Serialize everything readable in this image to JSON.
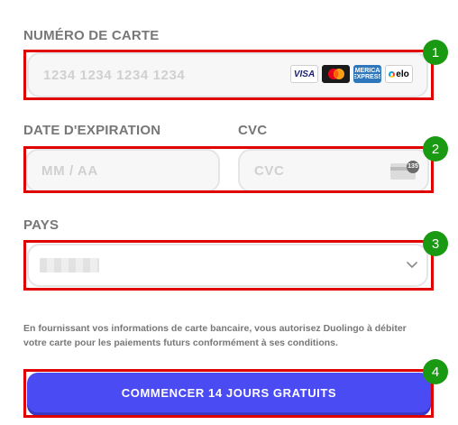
{
  "card_number": {
    "label": "NUMÉRO DE CARTE",
    "placeholder": "1234 1234 1234 1234",
    "value": "",
    "card_brands": [
      {
        "name": "visa",
        "text": "VISA",
        "icon": "visa-logo-icon"
      },
      {
        "name": "mastercard",
        "icon": "mastercard-logo-icon"
      },
      {
        "name": "amex",
        "text": "AMERICAN EXPRESS",
        "icon": "amex-logo-icon"
      },
      {
        "name": "elo",
        "text": "elo",
        "icon": "elo-logo-icon"
      }
    ]
  },
  "expiration": {
    "label": "DATE D'EXPIRATION",
    "placeholder": "MM / AA",
    "value": ""
  },
  "cvc": {
    "label": "CVC",
    "placeholder": "CVC",
    "value": "",
    "icon": "cvc-card-icon",
    "icon_text": "135"
  },
  "country": {
    "label": "PAYS",
    "selected_value": "",
    "icon": "chevron-down-icon"
  },
  "disclaimer": "En fournissant vos informations de carte bancaire, vous autorisez Duolingo à débiter votre carte pour les paiements futurs conformément à ses conditions.",
  "submit": {
    "label": "COMMENCER 14 JOURS GRATUITS"
  },
  "annotations": [
    {
      "number": "1"
    },
    {
      "number": "2"
    },
    {
      "number": "3"
    },
    {
      "number": "4"
    }
  ],
  "colors": {
    "accent": "#4b4bf4",
    "annotation_box": "#e00000",
    "annotation_marker": "#1a9a12",
    "label": "#777777",
    "placeholder": "#d0d0d0"
  }
}
